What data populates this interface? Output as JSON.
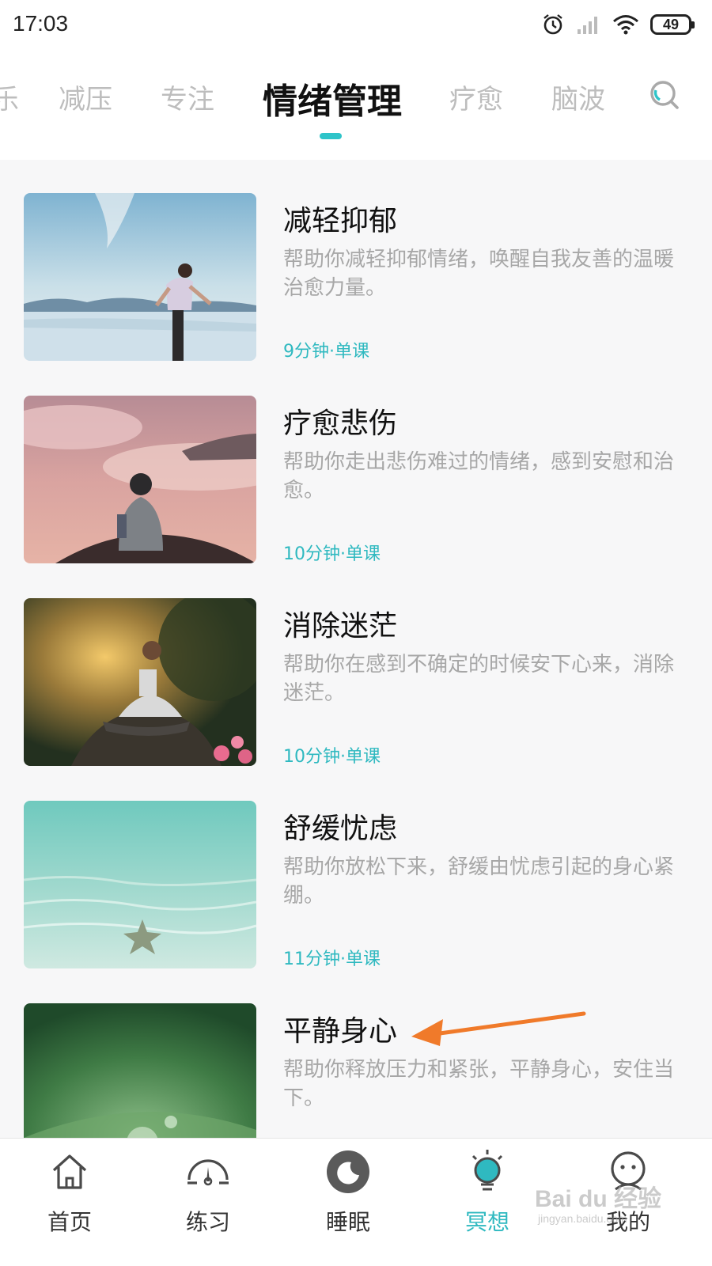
{
  "status_bar": {
    "time": "17:03",
    "battery": "49",
    "icons": [
      "alarm-icon",
      "signal-icon",
      "wifi-icon",
      "battery-icon"
    ]
  },
  "tabs": {
    "items": [
      {
        "label": "乐"
      },
      {
        "label": "减压"
      },
      {
        "label": "专注"
      },
      {
        "label": "情绪管理",
        "active": true
      },
      {
        "label": "疗愈"
      },
      {
        "label": "脑波"
      }
    ],
    "search_icon": "search-icon"
  },
  "courses": [
    {
      "title": "减轻抑郁",
      "description": "帮助你减轻抑郁情绪，唤醒自我友善的温暖治愈力量。",
      "meta": "9分钟·单课"
    },
    {
      "title": "疗愈悲伤",
      "description": "帮助你走出悲伤难过的情绪，感到安慰和治愈。",
      "meta": "10分钟·单课"
    },
    {
      "title": "消除迷茫",
      "description": "帮助你在感到不确定的时候安下心来，消除迷茫。",
      "meta": "10分钟·单课"
    },
    {
      "title": "舒缓忧虑",
      "description": "帮助你放松下来，舒缓由忧虑引起的身心紧绷。",
      "meta": "11分钟·单课"
    },
    {
      "title": "平静身心",
      "description": "帮助你释放压力和紧张，平静身心，安住当下。",
      "meta": ""
    }
  ],
  "bottom_nav": [
    {
      "label": "首页",
      "icon": "home-icon"
    },
    {
      "label": "练习",
      "icon": "gauge-icon"
    },
    {
      "label": "睡眠",
      "icon": "moon-icon"
    },
    {
      "label": "冥想",
      "icon": "lightbulb-icon",
      "active": true
    },
    {
      "label": "我的",
      "icon": "face-icon"
    }
  ],
  "watermark": {
    "text": "Bai du 经验",
    "sub": "jingyan.baidu.com"
  },
  "colors": {
    "accent": "#2fb9c0",
    "arrow": "#f07a2a",
    "background": "#f7f7f8"
  }
}
